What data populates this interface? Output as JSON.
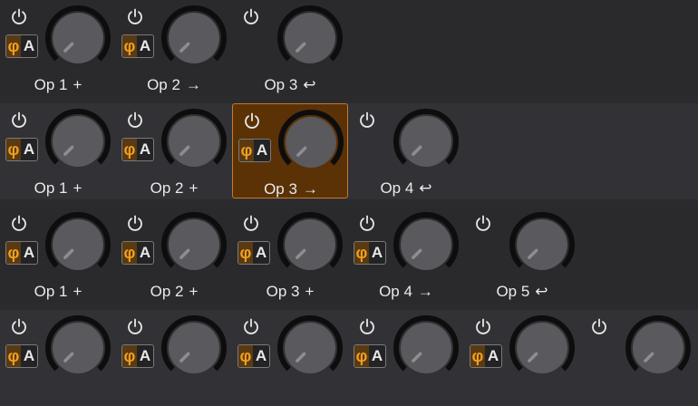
{
  "colors": {
    "background": "#2b2a2d",
    "knob_ring": "#0d0d0d",
    "knob_face": "#5a595d",
    "phase_accent": "#f0a020",
    "selected_bg": "#5a3206",
    "selected_border": "#c47a2a"
  },
  "icons": {
    "power": "power-icon",
    "phase": "phi-phase-icon",
    "knob": "rotary-knob"
  },
  "phase_button": {
    "phi": "φ",
    "amp": "A"
  },
  "rows": [
    {
      "bg": "#2a292c",
      "cells": [
        {
          "label": "Op 1",
          "arrow": "+",
          "power": true,
          "phase": true
        },
        {
          "label": "Op 2",
          "arrow": "→",
          "power": true,
          "phase": true
        },
        {
          "label": "Op 3",
          "arrow": "↩",
          "power": true,
          "phase": false
        },
        null,
        null,
        null
      ]
    },
    {
      "bg": "#323135",
      "cells": [
        {
          "label": "Op 1",
          "arrow": "+",
          "power": true,
          "phase": true
        },
        {
          "label": "Op 2",
          "arrow": "+",
          "power": true,
          "phase": true
        },
        {
          "label": "Op 3",
          "arrow": "→",
          "power": true,
          "phase": true,
          "selected": true
        },
        {
          "label": "Op 4",
          "arrow": "↩",
          "power": true,
          "phase": false
        },
        null,
        null
      ]
    },
    {
      "bg": "#2a292c",
      "cells": [
        {
          "label": "Op 1",
          "arrow": "+",
          "power": true,
          "phase": true
        },
        {
          "label": "Op 2",
          "arrow": "+",
          "power": true,
          "phase": true
        },
        {
          "label": "Op 3",
          "arrow": "+",
          "power": true,
          "phase": true
        },
        {
          "label": "Op 4",
          "arrow": "→",
          "power": true,
          "phase": true
        },
        {
          "label": "Op 5",
          "arrow": "↩",
          "power": true,
          "phase": false
        },
        null
      ]
    },
    {
      "bg": "#323135",
      "cells": [
        {
          "label": "",
          "arrow": "",
          "power": true,
          "phase": true
        },
        {
          "label": "",
          "arrow": "",
          "power": true,
          "phase": true
        },
        {
          "label": "",
          "arrow": "",
          "power": true,
          "phase": true
        },
        {
          "label": "",
          "arrow": "",
          "power": true,
          "phase": true
        },
        {
          "label": "",
          "arrow": "",
          "power": true,
          "phase": true
        },
        {
          "label": "",
          "arrow": "",
          "power": true,
          "phase": false
        }
      ]
    }
  ]
}
